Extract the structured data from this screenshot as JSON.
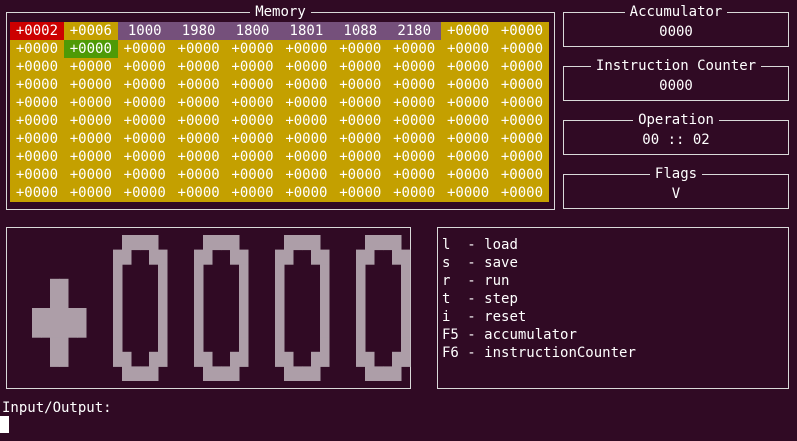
{
  "memory": {
    "title": "Memory",
    "rows": [
      [
        "+0002",
        "+0006",
        "1000",
        "1980",
        "1800",
        "1801",
        "1088",
        "2180",
        "+0000",
        "+0000"
      ],
      [
        "+0000",
        "+0000",
        "+0000",
        "+0000",
        "+0000",
        "+0000",
        "+0000",
        "+0000",
        "+0000",
        "+0000"
      ],
      [
        "+0000",
        "+0000",
        "+0000",
        "+0000",
        "+0000",
        "+0000",
        "+0000",
        "+0000",
        "+0000",
        "+0000"
      ],
      [
        "+0000",
        "+0000",
        "+0000",
        "+0000",
        "+0000",
        "+0000",
        "+0000",
        "+0000",
        "+0000",
        "+0000"
      ],
      [
        "+0000",
        "+0000",
        "+0000",
        "+0000",
        "+0000",
        "+0000",
        "+0000",
        "+0000",
        "+0000",
        "+0000"
      ],
      [
        "+0000",
        "+0000",
        "+0000",
        "+0000",
        "+0000",
        "+0000",
        "+0000",
        "+0000",
        "+0000",
        "+0000"
      ],
      [
        "+0000",
        "+0000",
        "+0000",
        "+0000",
        "+0000",
        "+0000",
        "+0000",
        "+0000",
        "+0000",
        "+0000"
      ],
      [
        "+0000",
        "+0000",
        "+0000",
        "+0000",
        "+0000",
        "+0000",
        "+0000",
        "+0000",
        "+0000",
        "+0000"
      ],
      [
        "+0000",
        "+0000",
        "+0000",
        "+0000",
        "+0000",
        "+0000",
        "+0000",
        "+0000",
        "+0000",
        "+0000"
      ],
      [
        "+0000",
        "+0000",
        "+0000",
        "+0000",
        "+0000",
        "+0000",
        "+0000",
        "+0000",
        "+0000",
        "+0000"
      ]
    ],
    "current_cell": [
      0,
      0
    ],
    "selected_cell": [
      1,
      1
    ],
    "highlighted_cells": [
      [
        0,
        2
      ],
      [
        0,
        3
      ],
      [
        0,
        4
      ],
      [
        0,
        5
      ],
      [
        0,
        6
      ],
      [
        0,
        7
      ]
    ]
  },
  "accumulator": {
    "title": "Accumulator",
    "value": "0000"
  },
  "instruction_counter": {
    "title": "Instruction Counter",
    "value": "0000"
  },
  "operation": {
    "title": "Operation",
    "value": "00 :: 02"
  },
  "flags": {
    "title": "Flags",
    "value": "V"
  },
  "big_display": {
    "symbols": [
      "+",
      "0",
      "0",
      "0",
      "0"
    ]
  },
  "keys": [
    {
      "key": "l ",
      "action": "load"
    },
    {
      "key": "s ",
      "action": "save"
    },
    {
      "key": "r ",
      "action": "run"
    },
    {
      "key": "t ",
      "action": "step"
    },
    {
      "key": "i ",
      "action": "reset"
    },
    {
      "key": "F5",
      "action": "accumulator"
    },
    {
      "key": "F6",
      "action": "instructionCounter"
    }
  ],
  "io": {
    "label": "Input/Output:"
  },
  "colors": {
    "background": "#300a24",
    "cell": "#c4a000",
    "cell_current": "#cc0000",
    "cell_selected": "#4e9a06",
    "cell_highlight": "#75507b",
    "big_glyph": "#ad9ea8"
  }
}
